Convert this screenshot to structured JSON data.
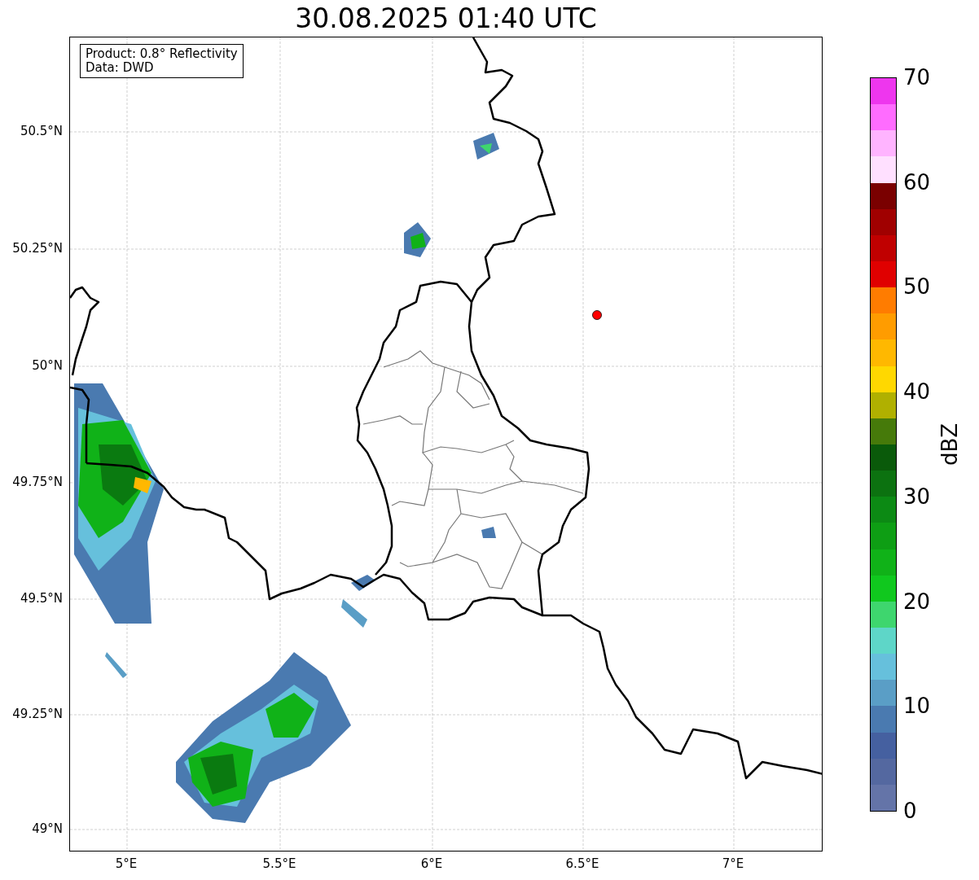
{
  "title": "30.08.2025 01:40 UTC",
  "info_box": {
    "lines": [
      "Product: 0.8° Reflectivity",
      "Data: DWD"
    ]
  },
  "y_ticks": [
    "50.5°N",
    "50.25°N",
    "50°N",
    "49.75°N",
    "49.5°N",
    "49.25°N",
    "49°N"
  ],
  "x_ticks": [
    "5°E",
    "5.5°E",
    "6°E",
    "6.5°E",
    "7°E"
  ],
  "colorbar": {
    "label": "dBZ",
    "ticks": [
      "70",
      "60",
      "50",
      "40",
      "30",
      "20",
      "10",
      "0"
    ],
    "segments": [
      {
        "color": "#ee36ee"
      },
      {
        "color": "#ff6cff"
      },
      {
        "color": "#ffb4ff"
      },
      {
        "color": "#ffe0ff"
      },
      {
        "color": "#7a0000"
      },
      {
        "color": "#a00000"
      },
      {
        "color": "#c00000"
      },
      {
        "color": "#e00000"
      },
      {
        "color": "#ff7c00"
      },
      {
        "color": "#ff9c00"
      },
      {
        "color": "#ffb800"
      },
      {
        "color": "#ffd800"
      },
      {
        "color": "#b0b000"
      },
      {
        "color": "#467a0a"
      },
      {
        "color": "#0a5a0a"
      },
      {
        "color": "#0c7210"
      },
      {
        "color": "#0c8a14"
      },
      {
        "color": "#0e9e14"
      },
      {
        "color": "#10b218"
      },
      {
        "color": "#10c81e"
      },
      {
        "color": "#3ed66e"
      },
      {
        "color": "#5ed6c8"
      },
      {
        "color": "#66c0dc"
      },
      {
        "color": "#5a9ec6"
      },
      {
        "color": "#4a7ab0"
      },
      {
        "color": "#4560a0"
      },
      {
        "color": "#5468a0"
      },
      {
        "color": "#6474a8"
      }
    ]
  }
}
